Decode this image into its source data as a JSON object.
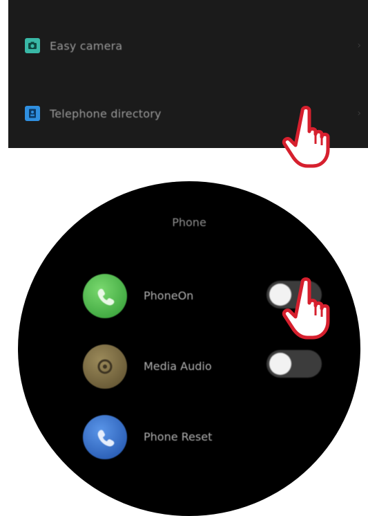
{
  "menu": {
    "items": [
      {
        "label": "Easy camera",
        "icon": "camera-icon",
        "icon_color": "#39b8a6"
      },
      {
        "label": "Telephone directory",
        "icon": "phonebook-icon",
        "icon_color": "#2f8fe0"
      }
    ]
  },
  "watch": {
    "title": "Phone",
    "settings": [
      {
        "label": "PhoneOn",
        "icon": "phone-call-icon",
        "toggle": "off"
      },
      {
        "label": "Media Audio",
        "icon": "media-audio-icon",
        "toggle": "off"
      },
      {
        "label": "Phone Reset",
        "icon": "phone-reset-icon"
      }
    ]
  },
  "colors": {
    "panel_bg": "#1b1b1b",
    "watch_bg": "#000000",
    "pointer_outline": "#d6202e"
  }
}
